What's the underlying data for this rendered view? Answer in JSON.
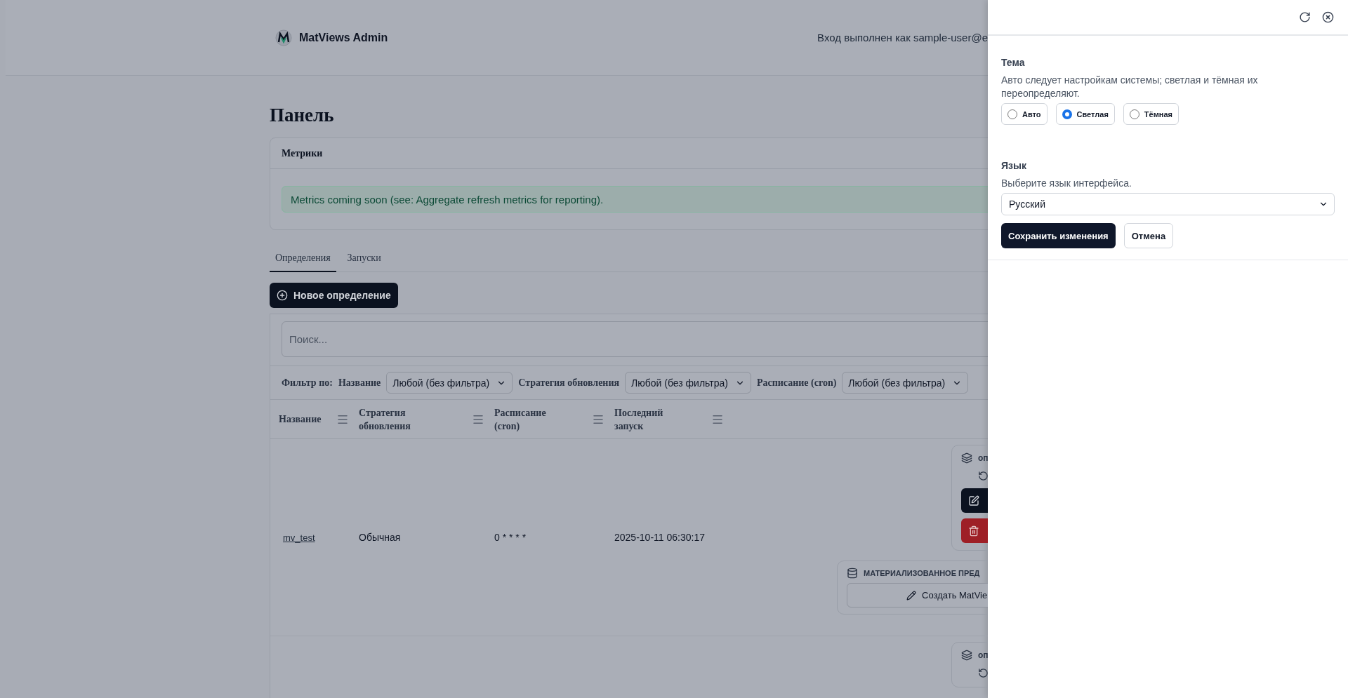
{
  "header": {
    "app_name": "MatViews Admin",
    "user_text": "Вход выполнен как sample-user@e"
  },
  "page_title": "Панель",
  "metrics": {
    "title": "Метрики",
    "message": "Metrics coming soon (see: Aggregate refresh metrics for reporting)."
  },
  "tabs": [
    {
      "label": "Определения",
      "selected": true
    },
    {
      "label": "Запуски",
      "selected": false
    }
  ],
  "new_button": "Новое определение",
  "search": {
    "placeholder": "Поиск..."
  },
  "filters": {
    "label": "Фильтр по:",
    "items": [
      {
        "label": "Название",
        "value": "Любой (без фильтра)"
      },
      {
        "label": "Стратегия обновления",
        "value": "Любой (без фильтра)"
      },
      {
        "label": "Расписание (cron)",
        "value": "Любой (без фильтра)"
      }
    ]
  },
  "table": {
    "columns": [
      "Название",
      "Стратегия обновления",
      "Расписание (cron)",
      "Последний запуск"
    ],
    "rows": [
      {
        "name": "mv_test",
        "strategy": "Обычная",
        "schedule": "0 * * * *",
        "last_run": "2025-10-11 06:30:17",
        "actions_title": "оп",
        "matview_title": "МАТЕРИАЛИЗОВАННОЕ ПРЕД",
        "matview_button": "Создать MatVie"
      },
      {
        "actions_title": "оп"
      }
    ]
  },
  "drawer": {
    "theme": {
      "title": "Тема",
      "description": "Авто следует настройкам системы; светлая и тёмная их переопределяют.",
      "options": [
        {
          "label": "Авто",
          "selected": false
        },
        {
          "label": "Светлая",
          "selected": true
        },
        {
          "label": "Тёмная",
          "selected": false
        }
      ]
    },
    "language": {
      "title": "Язык",
      "description": "Выберите язык интерфейса.",
      "value": "Русский"
    },
    "buttons": {
      "save": "Сохранить изменения",
      "cancel": "Отмена"
    }
  }
}
